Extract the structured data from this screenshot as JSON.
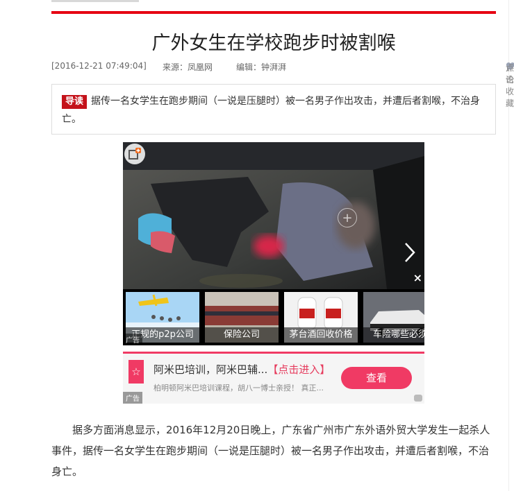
{
  "article": {
    "title": "广外女生在学校跑步时被割喉",
    "timestamp": "[2016-12-21 07:49:04]",
    "source": "来源：凤凰网",
    "editor": "编辑：钟湃湃",
    "comment_label": "评论",
    "favorite_label": "点击收藏",
    "lead_badge": "导读",
    "lead_text": "据传一名女学生在跑步期间（一说是压腿时）被一名男子作出攻击，并遭后者割喉，不治身亡。",
    "paragraph": "据多方面消息显示，2016年12月20日晚上，广东省广州市广东外语外贸大学发生一起杀人事件，据传一名女学生在跑步期间（一说是压腿时）被一名男子作出攻击，并遭后者割喉，不治身亡。"
  },
  "gallery": {
    "close": "×",
    "plus": "+",
    "ad_tag": "广告",
    "thumbs": [
      {
        "caption": "正规的p2p公司"
      },
      {
        "caption": "保险公司"
      },
      {
        "caption": "茅台酒回收价格"
      },
      {
        "caption": "车险哪些必须"
      }
    ]
  },
  "ad": {
    "title": "阿米巴培训，阿米巴辅...",
    "link": "【点击进入】",
    "desc": "柏明顿阿米巴培训课程，胡八一博士亲授！ 真正...",
    "button": "查看",
    "tag": "广告"
  },
  "colors": {
    "accent_red": "#e60012",
    "ad_pink": "#f03a64"
  },
  "icons": {
    "comment": "pencil-icon",
    "favorite": "heart-icon",
    "ad_star": "star-icon",
    "next": "chevron-right-icon",
    "close": "close-icon",
    "add": "add-to-collection-icon"
  }
}
